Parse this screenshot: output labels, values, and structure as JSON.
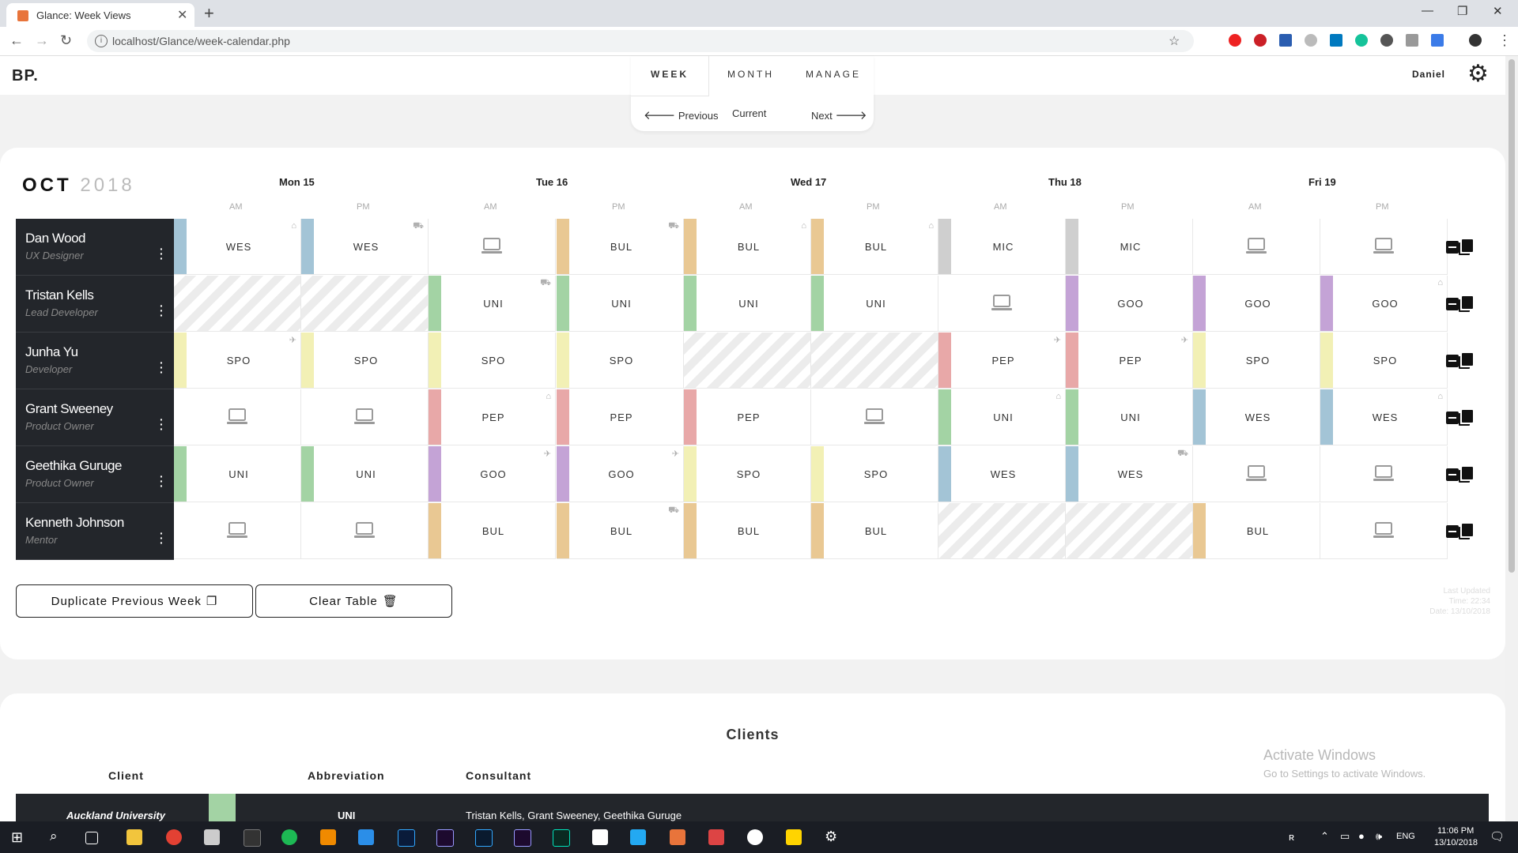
{
  "browser": {
    "tab_title": "Glance: Week Views",
    "url": "localhost/Glance/week-calendar.php"
  },
  "app": {
    "logo": "BP.",
    "nav": {
      "week": "WEEK",
      "month": "MONTH",
      "manage": "MANAGE"
    },
    "week_nav": {
      "previous": "Previous",
      "current": "Current",
      "next": "Next"
    },
    "user": "Daniel"
  },
  "calendar": {
    "month": "OCT",
    "year": "2018",
    "days": [
      "Mon 15",
      "Tue 16",
      "Wed 17",
      "Thu 18",
      "Fri 19"
    ],
    "am": "AM",
    "pm": "PM",
    "people": [
      {
        "name": "Dan Wood",
        "role": "UX Designer",
        "cells": [
          {
            "code": "WES",
            "color": "#a3c4d6",
            "icon": "home-icon"
          },
          {
            "code": "WES",
            "color": "#a3c4d6",
            "icon": "car-icon"
          },
          {
            "code": "",
            "color": "",
            "icon": "laptop-icon"
          },
          {
            "code": "BUL",
            "color": "#e9c893",
            "icon": "car-icon"
          },
          {
            "code": "BUL",
            "color": "#e9c893",
            "icon": "home-icon"
          },
          {
            "code": "BUL",
            "color": "#e9c893",
            "icon": "home-icon"
          },
          {
            "code": "MIC",
            "color": "#cfcfcf",
            "icon": ""
          },
          {
            "code": "MIC",
            "color": "#cfcfcf",
            "icon": ""
          },
          {
            "code": "",
            "color": "",
            "icon": "laptop-icon"
          },
          {
            "code": "",
            "color": "",
            "icon": "laptop-icon"
          }
        ]
      },
      {
        "name": "Tristan Kells",
        "role": "Lead Developer",
        "cells": [
          {
            "code": "",
            "color": "",
            "icon": "hatch"
          },
          {
            "code": "",
            "color": "",
            "icon": "hatch"
          },
          {
            "code": "UNI",
            "color": "#a3d3a4",
            "icon": "car-icon"
          },
          {
            "code": "UNI",
            "color": "#a3d3a4",
            "icon": ""
          },
          {
            "code": "UNI",
            "color": "#a3d3a4",
            "icon": ""
          },
          {
            "code": "UNI",
            "color": "#a3d3a4",
            "icon": ""
          },
          {
            "code": "",
            "color": "",
            "icon": "laptop-icon"
          },
          {
            "code": "GOO",
            "color": "#c4a3d6",
            "icon": ""
          },
          {
            "code": "GOO",
            "color": "#c4a3d6",
            "icon": ""
          },
          {
            "code": "GOO",
            "color": "#c4a3d6",
            "icon": "home-icon"
          }
        ]
      },
      {
        "name": "Junha Yu",
        "role": "Developer",
        "cells": [
          {
            "code": "SPO",
            "color": "#f2f0b5",
            "icon": "plane-icon"
          },
          {
            "code": "SPO",
            "color": "#f2f0b5",
            "icon": ""
          },
          {
            "code": "SPO",
            "color": "#f2f0b5",
            "icon": ""
          },
          {
            "code": "SPO",
            "color": "#f2f0b5",
            "icon": ""
          },
          {
            "code": "",
            "color": "",
            "icon": "hatch"
          },
          {
            "code": "",
            "color": "",
            "icon": "hatch"
          },
          {
            "code": "PEP",
            "color": "#e8a8a8",
            "icon": "plane-icon"
          },
          {
            "code": "PEP",
            "color": "#e8a8a8",
            "icon": "plane-icon"
          },
          {
            "code": "SPO",
            "color": "#f2f0b5",
            "icon": ""
          },
          {
            "code": "SPO",
            "color": "#f2f0b5",
            "icon": ""
          }
        ]
      },
      {
        "name": "Grant Sweeney",
        "role": "Product Owner",
        "cells": [
          {
            "code": "",
            "color": "",
            "icon": "laptop-icon"
          },
          {
            "code": "",
            "color": "",
            "icon": "laptop-icon"
          },
          {
            "code": "PEP",
            "color": "#e8a8a8",
            "icon": "home-icon"
          },
          {
            "code": "PEP",
            "color": "#e8a8a8",
            "icon": ""
          },
          {
            "code": "PEP",
            "color": "#e8a8a8",
            "icon": ""
          },
          {
            "code": "",
            "color": "",
            "icon": "laptop-icon"
          },
          {
            "code": "UNI",
            "color": "#a3d3a4",
            "icon": "home-icon"
          },
          {
            "code": "UNI",
            "color": "#a3d3a4",
            "icon": ""
          },
          {
            "code": "WES",
            "color": "#a3c4d6",
            "icon": ""
          },
          {
            "code": "WES",
            "color": "#a3c4d6",
            "icon": "home-icon"
          }
        ]
      },
      {
        "name": "Geethika Guruge",
        "role": "Product Owner",
        "cells": [
          {
            "code": "UNI",
            "color": "#a3d3a4",
            "icon": ""
          },
          {
            "code": "UNI",
            "color": "#a3d3a4",
            "icon": ""
          },
          {
            "code": "GOO",
            "color": "#c4a3d6",
            "icon": "plane-icon"
          },
          {
            "code": "GOO",
            "color": "#c4a3d6",
            "icon": "plane-icon"
          },
          {
            "code": "SPO",
            "color": "#f2f0b5",
            "icon": ""
          },
          {
            "code": "SPO",
            "color": "#f2f0b5",
            "icon": ""
          },
          {
            "code": "WES",
            "color": "#a3c4d6",
            "icon": ""
          },
          {
            "code": "WES",
            "color": "#a3c4d6",
            "icon": "car-icon"
          },
          {
            "code": "",
            "color": "",
            "icon": "laptop-icon"
          },
          {
            "code": "",
            "color": "",
            "icon": "laptop-icon"
          }
        ]
      },
      {
        "name": "Kenneth Johnson",
        "role": "Mentor",
        "cells": [
          {
            "code": "",
            "color": "",
            "icon": "laptop-icon"
          },
          {
            "code": "",
            "color": "",
            "icon": "laptop-icon"
          },
          {
            "code": "BUL",
            "color": "#e9c893",
            "icon": ""
          },
          {
            "code": "BUL",
            "color": "#e9c893",
            "icon": "car-icon"
          },
          {
            "code": "BUL",
            "color": "#e9c893",
            "icon": ""
          },
          {
            "code": "BUL",
            "color": "#e9c893",
            "icon": ""
          },
          {
            "code": "",
            "color": "",
            "icon": "hatch"
          },
          {
            "code": "",
            "color": "",
            "icon": "hatch"
          },
          {
            "code": "BUL",
            "color": "#e9c893",
            "icon": ""
          },
          {
            "code": "",
            "color": "",
            "icon": "laptop-icon"
          }
        ]
      }
    ],
    "buttons": {
      "duplicate": "Duplicate Previous Week",
      "clear": "Clear Table"
    },
    "updated": {
      "line1": "Last Updated",
      "line2": "Time: 22:34",
      "line3": "Date: 13/10/2018"
    }
  },
  "clients": {
    "title": "Clients",
    "headers": {
      "client": "Client",
      "abbreviation": "Abbreviation",
      "consultant": "Consultant"
    },
    "rows": [
      {
        "client": "Auckland University",
        "abbreviation": "UNI",
        "consultant": "Tristan Kells, Grant Sweeney, Geethika Guruge",
        "color": "#a3d3a4"
      }
    ]
  },
  "os": {
    "watermark_title": "Activate Windows",
    "watermark_sub": "Go to Settings to activate Windows.",
    "language": "ENG",
    "time": "11:06 PM",
    "date": "13/10/2018"
  }
}
